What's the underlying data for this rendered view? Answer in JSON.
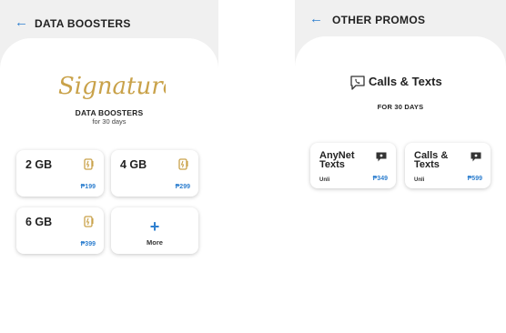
{
  "left": {
    "title": "DATA BOOSTERS",
    "signature_text": "Signature",
    "hero_title": "DATA BOOSTERS",
    "hero_sub": "for 30 days",
    "cards": [
      {
        "label": "2 GB",
        "price": "₱199"
      },
      {
        "label": "4 GB",
        "price": "₱299"
      },
      {
        "label": "6 GB",
        "price": "₱399"
      }
    ],
    "more": {
      "icon": "+",
      "label": "More"
    }
  },
  "right": {
    "title": "OTHER PROMOS",
    "hero_title": "Calls & Texts",
    "hero_sub": "FOR 30 DAYS",
    "cards": [
      {
        "name": "AnyNet Texts",
        "unli": "Unli",
        "price": "₱349"
      },
      {
        "name": "Calls & Texts",
        "unli": "Unli",
        "price": "₱599"
      }
    ]
  },
  "colors": {
    "accent": "#2e7fcf",
    "gold": "#c9a24a",
    "header_bg": "#f0f0f0"
  },
  "icons": {
    "back": "back-arrow-icon",
    "data": "data-booster-icon",
    "message": "message-icon",
    "phone": "phone-chat-icon"
  }
}
